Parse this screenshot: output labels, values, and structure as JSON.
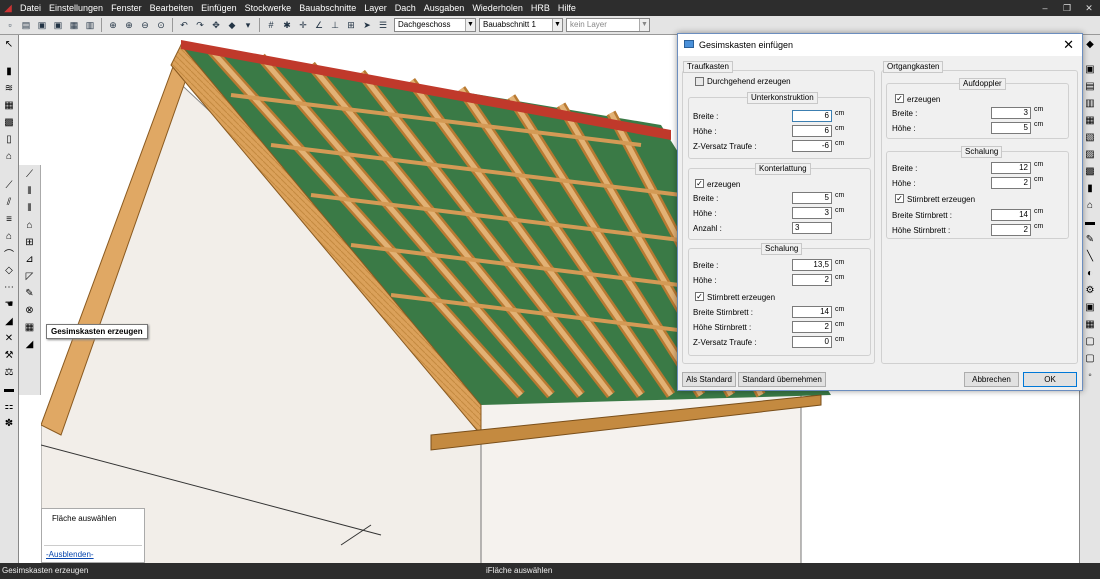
{
  "menu": [
    "Datei",
    "Einstellungen",
    "Fenster",
    "Bearbeiten",
    "Einfügen",
    "Stockwerke",
    "Bauabschnitte",
    "Layer",
    "Dach",
    "Ausgaben",
    "Wiederholen",
    "HRB",
    "Hilfe"
  ],
  "window_controls": [
    "‒",
    "❐",
    "✕"
  ],
  "toolbar": {
    "floor_combo": "Dachgeschoss",
    "section_combo": "Bauabschnitt 1",
    "layer_combo": "kein Layer"
  },
  "tooltip": "Gesimskasten erzeugen",
  "selection_panel": {
    "title": "Fläche auswählen",
    "link": "-Ausblenden-"
  },
  "status": {
    "left": "Gesimskasten erzeugen",
    "middle": "iFläche auswählen"
  },
  "dialog": {
    "title": "Gesimskasten einfügen",
    "traufkasten": {
      "legend": "Traufkasten",
      "durchgehend_label": "Durchgehend erzeugen",
      "unterkonstruktion": {
        "legend": "Unterkonstruktion",
        "breite_label": "Breite :",
        "breite": "6",
        "breite_unit": "cm",
        "hoehe_label": "Höhe :",
        "hoehe": "6",
        "hoehe_unit": "cm",
        "zversatz_label": "Z-Versatz Traufe :",
        "zversatz": "-6",
        "zversatz_unit": "cm"
      },
      "konterlattung": {
        "legend": "Konterlattung",
        "erzeugen_label": "erzeugen",
        "breite_label": "Breite :",
        "breite": "5",
        "breite_unit": "cm",
        "hoehe_label": "Höhe :",
        "hoehe": "3",
        "hoehe_unit": "cm",
        "anzahl_label": "Anzahl :",
        "anzahl": "3"
      },
      "schalung": {
        "legend": "Schalung",
        "breite_label": "Breite :",
        "breite": "13,5",
        "breite_unit": "cm",
        "hoehe_label": "Höhe :",
        "hoehe": "2",
        "hoehe_unit": "cm",
        "stirnbrett_label": "Stirnbrett erzeugen",
        "breite_stirn_label": "Breite Stirnbrett :",
        "breite_stirn": "14",
        "breite_stirn_unit": "cm",
        "hoehe_stirn_label": "Höhe Stirnbrett :",
        "hoehe_stirn": "2",
        "hoehe_stirn_unit": "cm",
        "zversatz_label": "Z-Versatz Traufe :",
        "zversatz": "0",
        "zversatz_unit": "cm"
      }
    },
    "ortgangkasten": {
      "legend": "Ortgangkasten",
      "aufdoppler": {
        "legend": "Aufdoppler",
        "erzeugen_label": "erzeugen",
        "breite_label": "Breite :",
        "breite": "3",
        "breite_unit": "cm",
        "hoehe_label": "Höhe :",
        "hoehe": "5",
        "hoehe_unit": "cm"
      },
      "schalung": {
        "legend": "Schalung",
        "breite_label": "Breite :",
        "breite": "12",
        "breite_unit": "cm",
        "hoehe_label": "Höhe :",
        "hoehe": "2",
        "hoehe_unit": "cm",
        "stirnbrett_label": "Stirnbrett erzeugen",
        "breite_stirn_label": "Breite Stirnbrett :",
        "breite_stirn": "14",
        "breite_stirn_unit": "cm",
        "hoehe_stirn_label": "Höhe Stirnbrett :",
        "hoehe_stirn": "2",
        "hoehe_stirn_unit": "cm"
      }
    },
    "buttons": {
      "als_standard": "Als Standard",
      "standard_uebernehmen": "Standard übernehmen",
      "abbrechen": "Abbrechen",
      "ok": "OK"
    }
  }
}
